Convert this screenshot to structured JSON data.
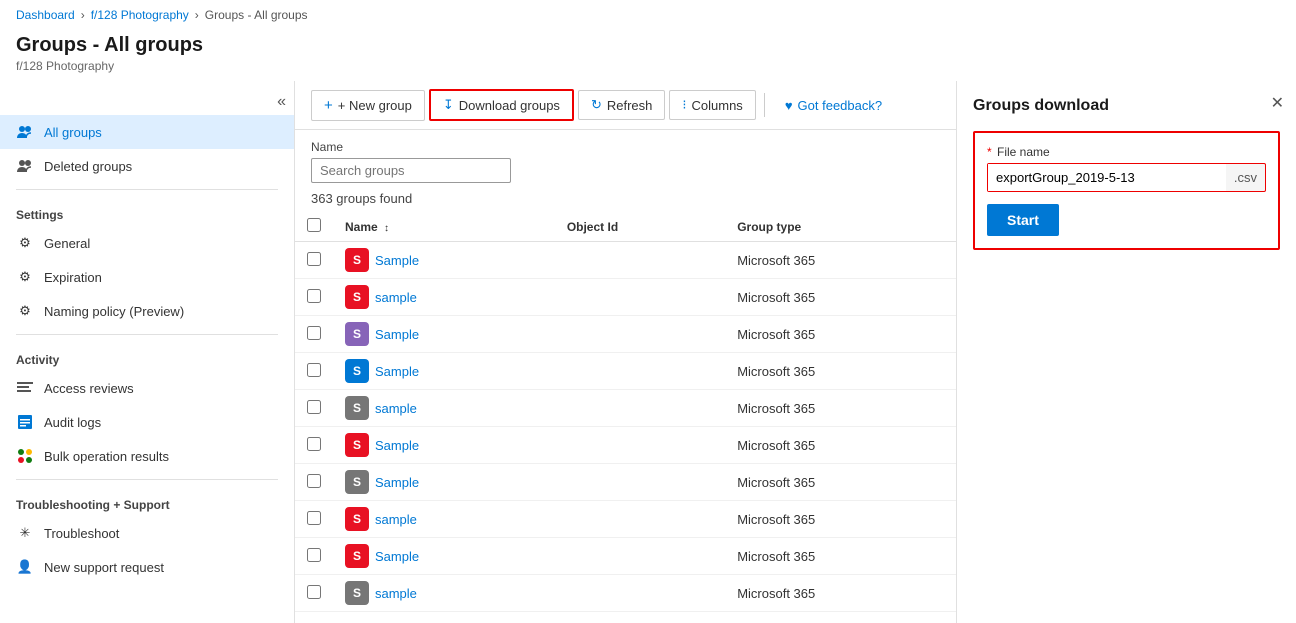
{
  "breadcrumb": {
    "items": [
      "Dashboard",
      "f/128 Photography",
      "Groups - All groups"
    ],
    "links": [
      true,
      true,
      false
    ]
  },
  "page": {
    "title": "Groups - All groups",
    "subtitle": "f/128 Photography"
  },
  "toolbar": {
    "new_group": "+ New group",
    "download_groups": "Download groups",
    "refresh": "Refresh",
    "columns": "Columns",
    "got_feedback": "Got feedback?"
  },
  "filter": {
    "name_label": "Name",
    "search_placeholder": "Search groups"
  },
  "groups_count": "363 groups found",
  "table": {
    "headers": [
      "Name",
      "Object Id",
      "Group type"
    ],
    "rows": [
      {
        "name": "Sample",
        "avatar_color": "#e81123",
        "object_id": "",
        "group_type": "Microsoft 365"
      },
      {
        "name": "sample",
        "avatar_color": "#e81123",
        "object_id": "",
        "group_type": "Microsoft 365"
      },
      {
        "name": "Sample",
        "avatar_color": "#8764b8",
        "object_id": "",
        "group_type": "Microsoft 365"
      },
      {
        "name": "Sample",
        "avatar_color": "#0078d4",
        "object_id": "",
        "group_type": "Microsoft 365"
      },
      {
        "name": "sample",
        "avatar_color": "#767676",
        "object_id": "",
        "group_type": "Microsoft 365"
      },
      {
        "name": "Sample",
        "avatar_color": "#e81123",
        "object_id": "",
        "group_type": "Microsoft 365"
      },
      {
        "name": "Sample",
        "avatar_color": "#767676",
        "object_id": "",
        "group_type": "Microsoft 365"
      },
      {
        "name": "sample",
        "avatar_color": "#e81123",
        "object_id": "",
        "group_type": "Microsoft 365"
      },
      {
        "name": "Sample",
        "avatar_color": "#e81123",
        "object_id": "",
        "group_type": "Microsoft 365"
      },
      {
        "name": "sample",
        "avatar_color": "#767676",
        "object_id": "",
        "group_type": "Microsoft 365"
      }
    ]
  },
  "sidebar": {
    "all_groups_label": "All groups",
    "deleted_groups_label": "Deleted groups",
    "settings_title": "Settings",
    "general_label": "General",
    "expiration_label": "Expiration",
    "naming_policy_label": "Naming policy (Preview)",
    "activity_title": "Activity",
    "access_reviews_label": "Access reviews",
    "audit_logs_label": "Audit logs",
    "bulk_ops_label": "Bulk operation results",
    "troubleshooting_title": "Troubleshooting + Support",
    "troubleshoot_label": "Troubleshoot",
    "new_support_label": "New support request"
  },
  "right_panel": {
    "title": "Groups download",
    "file_name_label": "File name",
    "file_name_required": "*",
    "file_name_value": "exportGroup_2019-5-13",
    "file_ext": ".csv",
    "start_label": "Start"
  }
}
